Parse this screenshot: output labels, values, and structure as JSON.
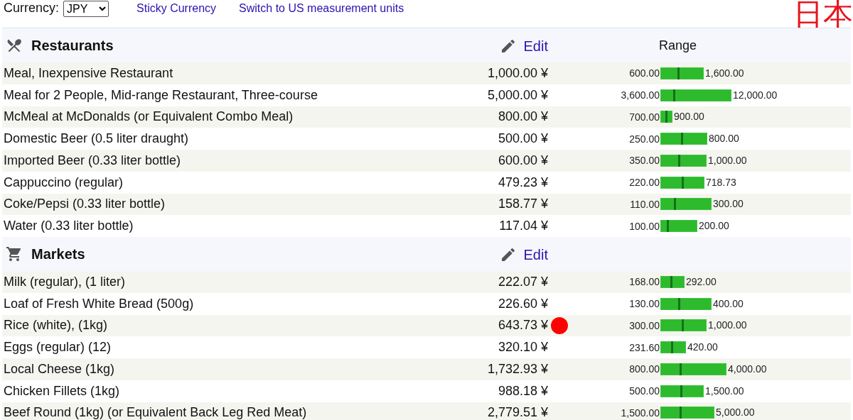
{
  "top_bar": {
    "currency_label": "Currency:",
    "currency_value": "JPY",
    "links": [
      "Sticky Currency",
      "Switch to US measurement units"
    ],
    "country": "日本"
  },
  "sections": [
    {
      "title": "Restaurants",
      "edit": "Edit",
      "range_heading": "Range",
      "rows": [
        {
          "name": "Meal, Inexpensive Restaurant",
          "price": "1,000.00 ¥",
          "marked": false,
          "range_min": "600.00",
          "range_max": "1,600.00",
          "span": {
            "level": 0.61
          },
          "average": {
            "level": 0.25
          }
        },
        {
          "name": "Meal for 2 People, Mid-range Restaurant, Three-course",
          "price": "5,000.00 ¥",
          "marked": false,
          "range_min": "3,600.00",
          "range_max": "12,000.00",
          "span": {
            "level": 1.0
          },
          "average": {
            "level": 0.19
          }
        },
        {
          "name": "McMeal at McDonalds (or Equivalent Combo Meal)",
          "price": "800.00 ¥",
          "marked": false,
          "range_min": "700.00",
          "range_max": "900.00",
          "span": {
            "level": 0.17
          },
          "average": {
            "level": 0.08
          }
        },
        {
          "name": "Domestic Beer (0.5 liter draught)",
          "price": "500.00 ¥",
          "marked": false,
          "range_min": "250.00",
          "range_max": "800.00",
          "span": {
            "level": 0.66
          },
          "average": {
            "level": 0.3
          }
        },
        {
          "name": "Imported Beer (0.33 liter bottle)",
          "price": "600.00 ¥",
          "marked": false,
          "range_min": "350.00",
          "range_max": "1,000.00",
          "span": {
            "level": 0.65
          },
          "average": {
            "level": 0.26
          }
        },
        {
          "name": "Cappuccino (regular)",
          "price": "479.23 ¥",
          "marked": false,
          "range_min": "220.00",
          "range_max": "718.73",
          "span": {
            "level": 0.62
          },
          "average": {
            "level": 0.31
          }
        },
        {
          "name": "Coke/Pepsi (0.33 liter bottle)",
          "price": "158.77 ¥",
          "marked": false,
          "range_min": "110.00",
          "range_max": "300.00",
          "span": {
            "level": 0.72
          },
          "average": {
            "level": 0.2
          }
        },
        {
          "name": "Water (0.33 liter bottle)",
          "price": "117.04 ¥",
          "marked": false,
          "range_min": "100.00",
          "range_max": "200.00",
          "span": {
            "level": 0.52
          },
          "average": {
            "level": 0.1
          }
        }
      ]
    },
    {
      "title": "Markets",
      "edit": "Edit",
      "rows": [
        {
          "name": "Milk (regular), (1 liter)",
          "price": "222.07 ¥",
          "marked": false,
          "range_min": "168.00",
          "range_max": "292.00",
          "span": {
            "level": 0.34
          },
          "average": {
            "level": 0.15
          }
        },
        {
          "name": "Loaf of Fresh White Bread (500g)",
          "price": "226.60 ¥",
          "marked": false,
          "range_min": "130.00",
          "range_max": "400.00",
          "span": {
            "level": 0.72
          },
          "average": {
            "level": 0.26
          }
        },
        {
          "name": "Rice (white), (1kg)",
          "price": "643.73 ¥",
          "marked": true,
          "range_min": "300.00",
          "range_max": "1,000.00",
          "span": {
            "level": 0.65
          },
          "average": {
            "level": 0.31
          }
        },
        {
          "name": "Eggs (regular) (12)",
          "price": "320.10 ¥",
          "marked": false,
          "range_min": "231.60",
          "range_max": "420.00",
          "span": {
            "level": 0.36
          },
          "average": {
            "level": 0.16
          }
        },
        {
          "name": "Local Cheese (1kg)",
          "price": "1,732.93 ¥",
          "marked": false,
          "range_min": "800.00",
          "range_max": "4,000.00",
          "span": {
            "level": 0.93
          },
          "average": {
            "level": 0.28
          }
        },
        {
          "name": "Chicken Fillets (1kg)",
          "price": "988.18 ¥",
          "marked": false,
          "range_min": "500.00",
          "range_max": "1,500.00",
          "span": {
            "level": 0.61
          },
          "average": {
            "level": 0.29
          }
        },
        {
          "name": "Beef Round (1kg) (or Equivalent Back Leg Red Meat)",
          "price": "2,779.51 ¥",
          "marked": false,
          "range_min": "1,500.00",
          "range_max": "5,000.00",
          "span": {
            "level": 0.76
          },
          "average": {
            "level": 0.28
          }
        }
      ]
    }
  ]
}
